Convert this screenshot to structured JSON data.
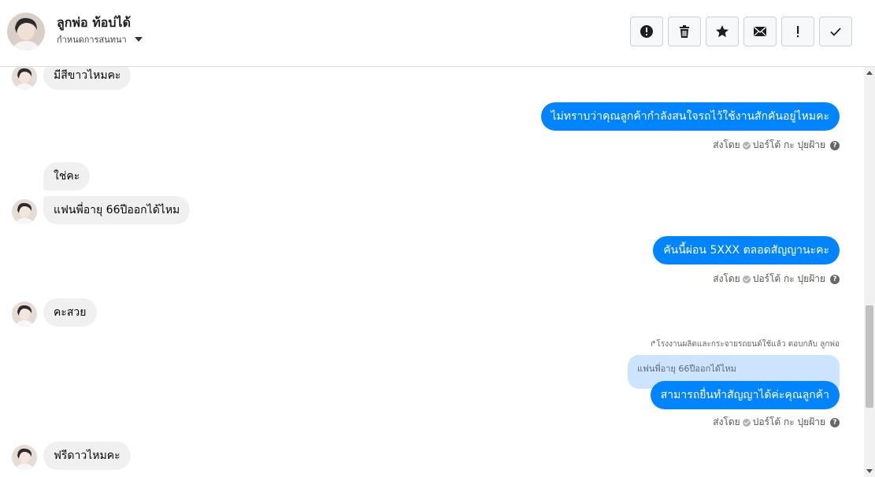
{
  "header": {
    "contact_name": "ลูกพ่อ ท้อบ่ได้",
    "assign_label": "กำหนดการสนทนา",
    "actions": [
      {
        "name": "spam-button",
        "icon": "alert-circle-icon"
      },
      {
        "name": "delete-button",
        "icon": "trash-icon"
      },
      {
        "name": "star-button",
        "icon": "star-icon"
      },
      {
        "name": "mark-unread-button",
        "icon": "envelope-icon"
      },
      {
        "name": "important-button",
        "icon": "exclamation-icon"
      },
      {
        "name": "done-button",
        "icon": "check-icon"
      }
    ]
  },
  "messages": {
    "m1": "มีสีขาวไหมคะ",
    "m2": "ไม่ทราบว่าคุณลูกค้ากำลังสนใจรถไว้ใช้งานสักคันอยู่ไหมคะ",
    "m3": "ใช่คะ",
    "m4": "แฟนพี่อายุ 66ปีออกได้ไหม",
    "m5": "คันนี้ผ่อน 5XXX  ตลอดสัญญานะคะ",
    "m6": "คะสวย",
    "m7_reply_note": "โรงงานผลิตและกระจายรถยนต์ใช้แล้ว ตอบกลับ ลูกพ่อ",
    "m7_quoted": "แฟนพี่อายุ 66ปีออกได้ไหม",
    "m7": "สามารถยื่นทำสัญญาได้ค่ะคุณลูกค้า",
    "m8": "ฟรีดาวไหมคะ"
  },
  "sent_by": {
    "prefix": "ส่งโดย",
    "agent": "ปอร์โต้ กะ ปุยฝ้าย",
    "help": "?"
  },
  "colors": {
    "outgoing_bubble": "#0084ff",
    "incoming_bubble": "#f0f0f0",
    "quoted_bubble": "#cce4ff"
  }
}
